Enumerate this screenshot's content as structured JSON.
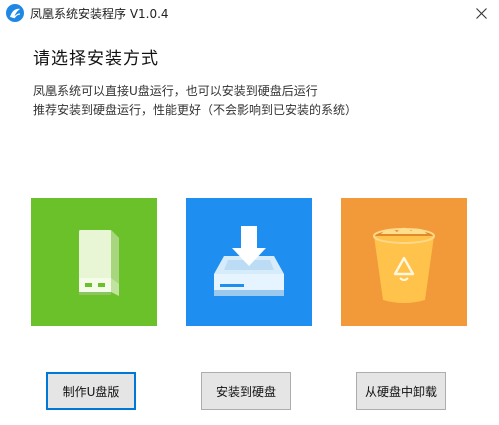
{
  "window": {
    "title": "凤凰系统安装程序 V1.0.4"
  },
  "main": {
    "heading": "请选择安装方式",
    "description_line1": "凤凰系统可以直接U盘运行，也可以安装到硬盘后运行",
    "description_line2": "推荐安装到硬盘运行，性能更好（不会影响到已安装的系统）"
  },
  "options": [
    {
      "icon": "usb-drive-icon",
      "color": "#6ac12a",
      "button_label": "制作U盘版"
    },
    {
      "icon": "hard-disk-install-icon",
      "color": "#1e8ff0",
      "button_label": "安装到硬盘"
    },
    {
      "icon": "recycle-bin-icon",
      "color": "#f29a3a",
      "button_label": "从硬盘中卸载"
    }
  ]
}
